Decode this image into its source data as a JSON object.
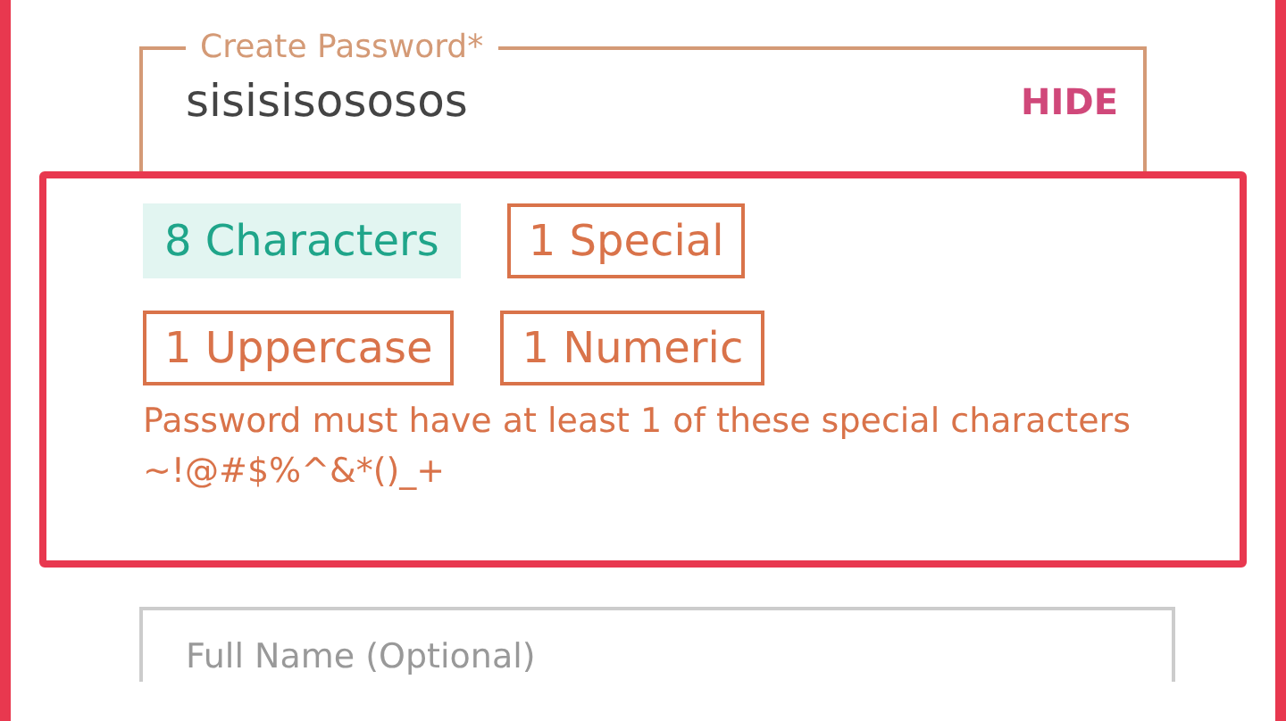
{
  "password_field": {
    "label": "Create Password*",
    "value": "sisisisososos",
    "toggle": "HIDE"
  },
  "requirements": [
    {
      "label": "8 Characters",
      "met": true
    },
    {
      "label": "1 Special",
      "met": false
    },
    {
      "label": "1 Uppercase",
      "met": false
    },
    {
      "label": "1 Numeric",
      "met": false
    }
  ],
  "hint": "Password must have at least 1 of these special characters ~!@#$%^&*()_+",
  "name_field": {
    "placeholder": "Full Name (Optional)"
  }
}
